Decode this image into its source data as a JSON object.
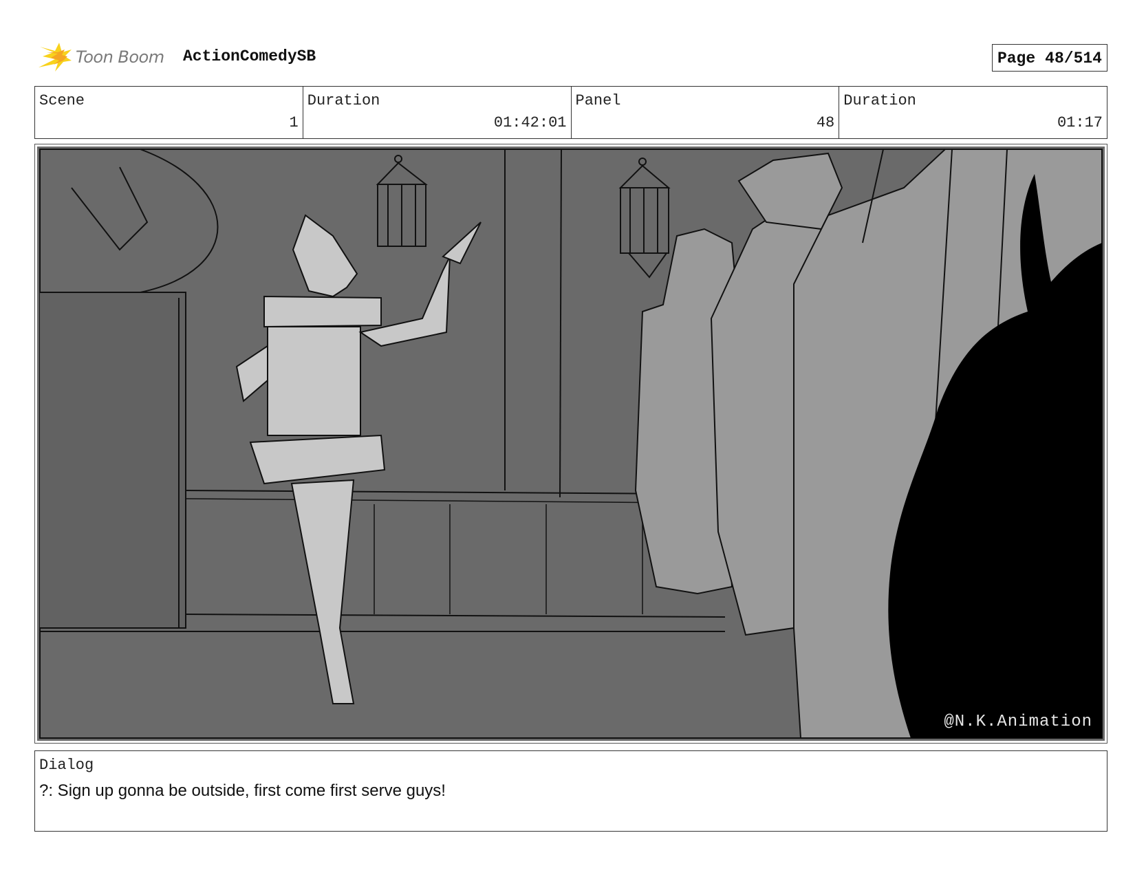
{
  "header": {
    "logo_text": "Toon Boom",
    "project_title": "ActionComedySB",
    "page_label": "Page",
    "page_number": "48/514"
  },
  "info": {
    "scene_label": "Scene",
    "scene_value": "1",
    "scene_duration_label": "Duration",
    "scene_duration_value": "01:42:01",
    "panel_label": "Panel",
    "panel_value": "48",
    "panel_duration_label": "Duration",
    "panel_duration_value": "01:17"
  },
  "panel": {
    "watermark": "@N.K.Animation"
  },
  "dialog": {
    "label": "Dialog",
    "text": "?: Sign up gonna be outside, first come first serve guys!"
  },
  "colors": {
    "logo_orange": "#f5a623",
    "logo_yellow": "#f8d21c",
    "panel_background": "#6a6a6a"
  }
}
